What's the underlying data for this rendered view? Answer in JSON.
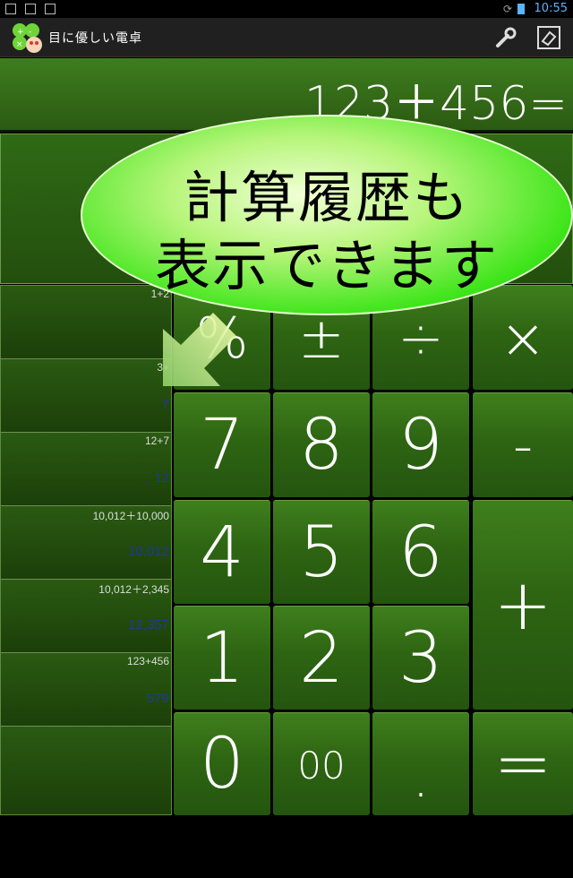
{
  "status_bar": {
    "time": "10:55"
  },
  "app": {
    "title": "目に優しい電卓"
  },
  "display": {
    "value": "123＋456="
  },
  "bubble": {
    "line1": "計算履歴も",
    "line2": "表示できます"
  },
  "history": [
    {
      "expr": "1+2",
      "result": ""
    },
    {
      "expr": "3+",
      "result": "7"
    },
    {
      "expr": "12+7",
      "result": "12"
    },
    {
      "expr": "10,012＋10,000",
      "result": "10,012"
    },
    {
      "expr": "10,012＋2,345",
      "result": "12,357"
    },
    {
      "expr": "123+456",
      "result": "579"
    },
    {
      "expr": "",
      "result": ""
    }
  ],
  "keys": {
    "percent": "%",
    "plus_minus": "±",
    "divide": "÷",
    "multiply": "×",
    "seven": "7",
    "eight": "8",
    "nine": "9",
    "minus": "-",
    "four": "4",
    "five": "5",
    "six": "6",
    "plus": "+",
    "one": "1",
    "two": "2",
    "three": "3",
    "zero": "0",
    "double_zero": "00",
    "decimal": ".",
    "equals": "="
  },
  "colors": {
    "key_green": "#2e6512",
    "bubble_green": "#3ee51a",
    "history_blue": "#1d3a9a",
    "time_blue": "#5ab4ff"
  }
}
